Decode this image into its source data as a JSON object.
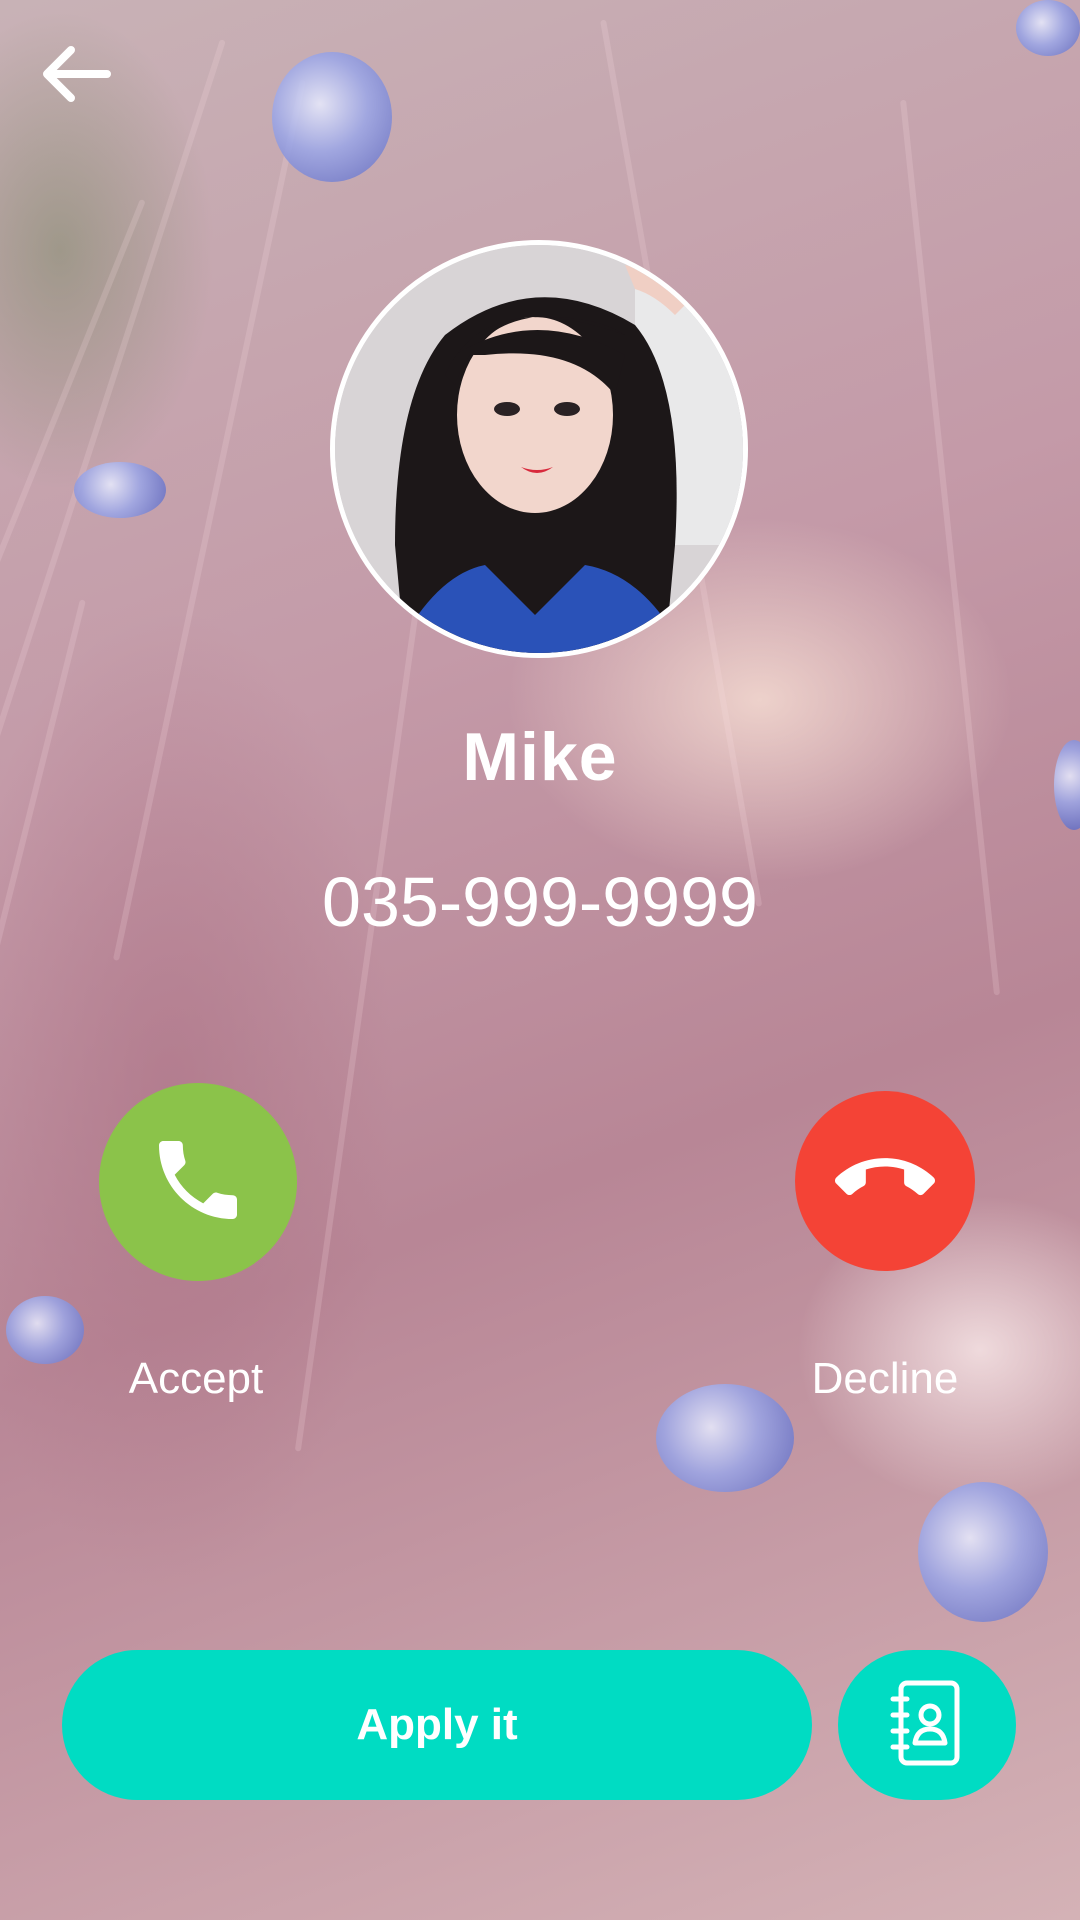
{
  "theme": {
    "accent": "#00dcc3",
    "accept_color": "#8bc34a",
    "decline_color": "#f44336"
  },
  "toolbar": {
    "back_icon": "arrow-left-icon"
  },
  "caller": {
    "avatar": "caller-photo",
    "name": "Mike",
    "number": "035-999-9999"
  },
  "actions": {
    "accept_label": "Accept",
    "accept_icon": "phone-icon",
    "decline_label": "Decline",
    "decline_icon": "phone-hangup-icon"
  },
  "footer": {
    "apply_label": "Apply it",
    "contacts_icon": "contact-book-icon"
  }
}
